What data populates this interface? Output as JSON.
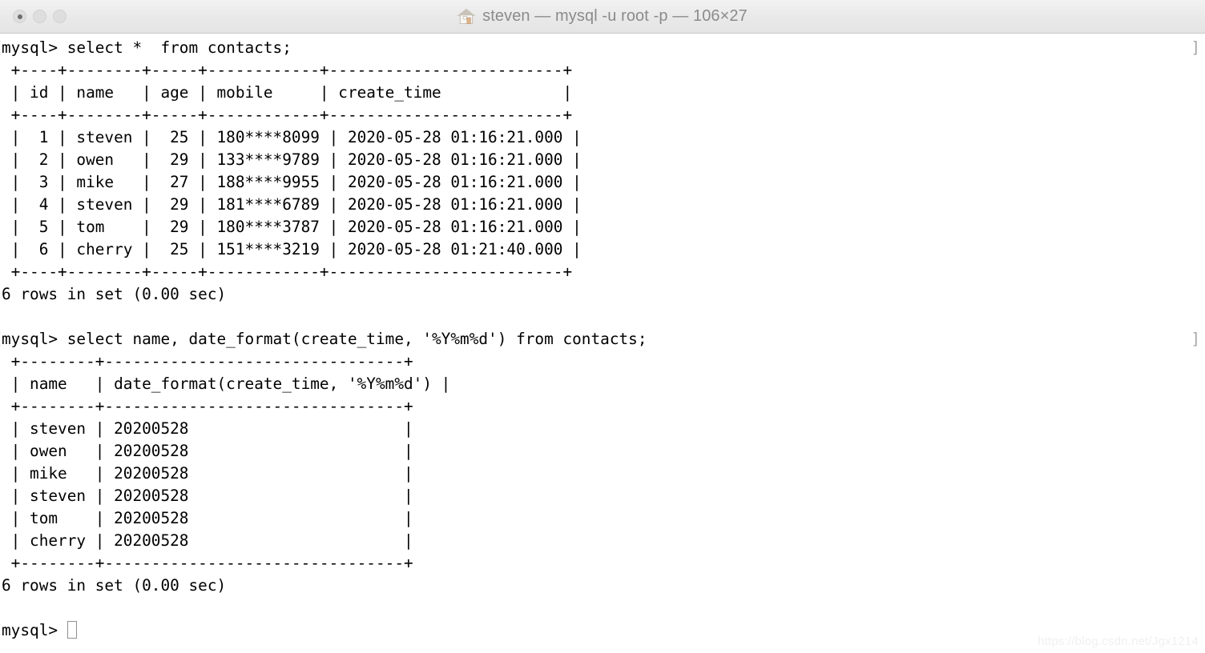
{
  "window": {
    "title": "steven — mysql -u root -p — 106×27",
    "icon": "home-icon",
    "cols": 106,
    "rows": 27,
    "traffic_lights": {
      "close_label": "close",
      "minimize_label": "minimize",
      "zoom_label": "zoom"
    }
  },
  "terminal": {
    "prompt": "mysql>",
    "prompt_mark_left": "[",
    "prompt_mark_right": "]",
    "lines": [
      {
        "type": "prompt",
        "text": "mysql> select *  from contacts;"
      },
      {
        "type": "output",
        "text": " +----+--------+-----+------------+-------------------------+"
      },
      {
        "type": "output",
        "text": " | id | name   | age | mobile     | create_time             |"
      },
      {
        "type": "output",
        "text": " +----+--------+-----+------------+-------------------------+"
      },
      {
        "type": "output",
        "text": " |  1 | steven |  25 | 180****8099 | 2020-05-28 01:16:21.000 |"
      },
      {
        "type": "output",
        "text": " |  2 | owen   |  29 | 133****9789 | 2020-05-28 01:16:21.000 |"
      },
      {
        "type": "output",
        "text": " |  3 | mike   |  27 | 188****9955 | 2020-05-28 01:16:21.000 |"
      },
      {
        "type": "output",
        "text": " |  4 | steven |  29 | 181****6789 | 2020-05-28 01:16:21.000 |"
      },
      {
        "type": "output",
        "text": " |  5 | tom    |  29 | 180****3787 | 2020-05-28 01:16:21.000 |"
      },
      {
        "type": "output",
        "text": " |  6 | cherry |  25 | 151****3219 | 2020-05-28 01:21:40.000 |"
      },
      {
        "type": "output",
        "text": " +----+--------+-----+------------+-------------------------+"
      },
      {
        "type": "output",
        "text": "6 rows in set (0.00 sec)"
      },
      {
        "type": "blank",
        "text": ""
      },
      {
        "type": "prompt",
        "text": "mysql> select name, date_format(create_time, '%Y%m%d') from contacts;"
      },
      {
        "type": "output",
        "text": " +--------+--------------------------------+"
      },
      {
        "type": "output",
        "text": " | name   | date_format(create_time, '%Y%m%d') |"
      },
      {
        "type": "output",
        "text": " +--------+--------------------------------+"
      },
      {
        "type": "output",
        "text": " | steven | 20200528                       |"
      },
      {
        "type": "output",
        "text": " | owen   | 20200528                       |"
      },
      {
        "type": "output",
        "text": " | mike   | 20200528                       |"
      },
      {
        "type": "output",
        "text": " | steven | 20200528                       |"
      },
      {
        "type": "output",
        "text": " | tom    | 20200528                       |"
      },
      {
        "type": "output",
        "text": " | cherry | 20200528                       |"
      },
      {
        "type": "output",
        "text": " +--------+--------------------------------+"
      },
      {
        "type": "output",
        "text": "6 rows in set (0.00 sec)"
      },
      {
        "type": "blank",
        "text": ""
      },
      {
        "type": "cursor",
        "text": "mysql> "
      }
    ],
    "queries": [
      "select *  from contacts;",
      "select name, date_format(create_time, '%Y%m%d') from contacts;"
    ],
    "result_sets": [
      {
        "columns": [
          "id",
          "name",
          "age",
          "mobile",
          "create_time"
        ],
        "rows": [
          [
            "1",
            "steven",
            "25",
            "180****8099",
            "2020-05-28 01:16:21.000"
          ],
          [
            "2",
            "owen",
            "29",
            "133****9789",
            "2020-05-28 01:16:21.000"
          ],
          [
            "3",
            "mike",
            "27",
            "188****9955",
            "2020-05-28 01:16:21.000"
          ],
          [
            "4",
            "steven",
            "29",
            "181****6789",
            "2020-05-28 01:16:21.000"
          ],
          [
            "5",
            "tom",
            "29",
            "180****3787",
            "2020-05-28 01:16:21.000"
          ],
          [
            "6",
            "cherry",
            "25",
            "151****3219",
            "2020-05-28 01:21:40.000"
          ]
        ],
        "status": "6 rows in set (0.00 sec)"
      },
      {
        "columns": [
          "name",
          "date_format(create_time, '%Y%m%d')"
        ],
        "rows": [
          [
            "steven",
            "20200528"
          ],
          [
            "owen",
            "20200528"
          ],
          [
            "mike",
            "20200528"
          ],
          [
            "steven",
            "20200528"
          ],
          [
            "tom",
            "20200528"
          ],
          [
            "cherry",
            "20200528"
          ]
        ],
        "status": "6 rows in set (0.00 sec)"
      }
    ]
  },
  "watermark": {
    "text": "https://blog.csdn.net/Jgx1214"
  },
  "colors": {
    "titlebar_top": "#f2f2f2",
    "titlebar_bottom": "#e4e4e4",
    "titlebar_border": "#c8c8c8",
    "title_text": "#8b8b8b",
    "terminal_bg": "#ffffff",
    "terminal_fg": "#000000",
    "mark": "#b4b4b4",
    "cursor_outline": "#8f8f8f",
    "watermark": "#f0f0f0"
  }
}
